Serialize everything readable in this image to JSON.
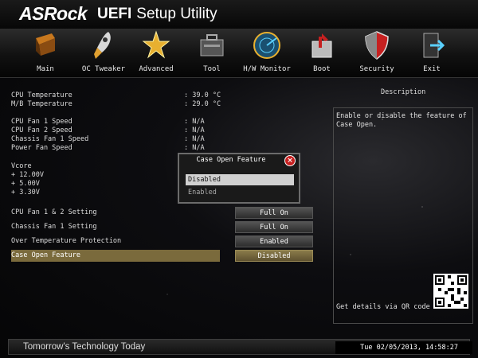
{
  "header": {
    "brand": "ASRock",
    "title_bold": "UEFI",
    "title_rest": "Setup Utility"
  },
  "tabs": [
    {
      "label": "Main",
      "icon": "main-icon"
    },
    {
      "label": "OC Tweaker",
      "icon": "rocket-icon"
    },
    {
      "label": "Advanced",
      "icon": "star-icon"
    },
    {
      "label": "Tool",
      "icon": "toolbox-icon"
    },
    {
      "label": "H/W Monitor",
      "icon": "radar-icon"
    },
    {
      "label": "Boot",
      "icon": "boot-icon"
    },
    {
      "label": "Security",
      "icon": "shield-icon"
    },
    {
      "label": "Exit",
      "icon": "exit-icon"
    }
  ],
  "monitor": {
    "cpu_temp_label": "CPU Temperature",
    "cpu_temp_value": ": 39.0 °C",
    "mb_temp_label": "M/B Temperature",
    "mb_temp_value": ": 29.0 °C",
    "fan1_label": "CPU Fan 1 Speed",
    "fan1_value": ": N/A",
    "fan2_label": "CPU Fan 2 Speed",
    "fan2_value": ": N/A",
    "chassis_label": "Chassis Fan 1 Speed",
    "chassis_value": ": N/A",
    "power_label": "Power Fan Speed",
    "power_value": ": N/A",
    "vcore_label": "Vcore",
    "v12_label": "+ 12.00V",
    "v5_label": "+ 5.00V",
    "v33_label": "+ 3.30V"
  },
  "settings": [
    {
      "label": "CPU Fan 1 & 2 Setting",
      "value": "Full On"
    },
    {
      "label": "Chassis Fan 1 Setting",
      "value": "Full On"
    },
    {
      "label": "Over Temperature Protection",
      "value": "Enabled"
    },
    {
      "label": "Case Open Feature",
      "value": "Disabled"
    }
  ],
  "description": {
    "heading": "Description",
    "text": "Enable or disable the feature of Case Open.",
    "qr_text": "Get details via QR code"
  },
  "popup": {
    "title": "Case Open Feature",
    "close": "×",
    "options": [
      "Disabled",
      "Enabled"
    ],
    "selected": "Disabled"
  },
  "footer": {
    "tagline": "Tomorrow's Technology Today",
    "datetime": "Tue 02/05/2013, 14:58:27"
  },
  "colors": {
    "highlight": "#7a6a3c",
    "close_red": "#c62020"
  }
}
